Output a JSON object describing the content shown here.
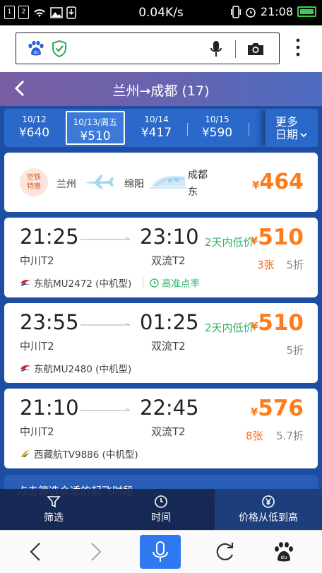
{
  "status_bar": {
    "sim1": "1",
    "sim2": "2",
    "network_speed": "0.04K/s",
    "time": "21:08"
  },
  "browser_search": {
    "logo_icon": "baidu-paw-icon",
    "shield_icon": "shield-check-icon",
    "voice_icon": "microphone-icon",
    "camera_icon": "camera-icon",
    "menu_icon": "more-vertical-icon"
  },
  "header": {
    "title": "兰州→成都 (17)"
  },
  "dates": [
    {
      "date": "10/12",
      "price": "¥640"
    },
    {
      "date": "10/13/周五",
      "price": "¥510",
      "active": true
    },
    {
      "date": "10/14",
      "price": "¥417"
    },
    {
      "date": "10/15",
      "price": "¥590"
    },
    {
      "date": "",
      "price": "¥"
    }
  ],
  "more_dates": {
    "line1": "更多",
    "line2": "日期"
  },
  "transfer": {
    "badge_line1": "空铁",
    "badge_line2": "特惠",
    "from": "兰州",
    "via": "绵阳",
    "to_line1": "成都",
    "to_line2": "东",
    "currency": "¥",
    "price": "464"
  },
  "flights": [
    {
      "dep_time": "21:25",
      "arr_time": "23:10",
      "dep_airport": "中川T2",
      "arr_airport": "双流T2",
      "tag": "2天内低价",
      "currency": "¥",
      "price": "510",
      "seats": "3张",
      "discount": "5折",
      "airline": "东航MU2472 (中机型)",
      "ontime": "高准点率"
    },
    {
      "dep_time": "23:55",
      "arr_time": "01:25",
      "dep_airport": "中川T2",
      "arr_airport": "双流T2",
      "tag": "2天内低价",
      "currency": "¥",
      "price": "510",
      "seats": "",
      "discount": "5折",
      "airline": "东航MU2480 (中机型)",
      "ontime": ""
    },
    {
      "dep_time": "21:10",
      "arr_time": "22:45",
      "dep_airport": "中川T2",
      "arr_airport": "双流T2",
      "tag": "",
      "currency": "¥",
      "price": "576",
      "seats": "8张",
      "discount": "5.7折",
      "airline": "西藏航TV9886 (中机型)",
      "ontime": ""
    }
  ],
  "hint": "点击筛选合适的起飞时段",
  "filter_bar": {
    "filter": "筛选",
    "time": "时间",
    "sort_price": "价格从低到高"
  },
  "colors": {
    "accent_orange": "#ff7a1a",
    "green": "#34b36a",
    "blue_bg": "#1e4ea3"
  }
}
